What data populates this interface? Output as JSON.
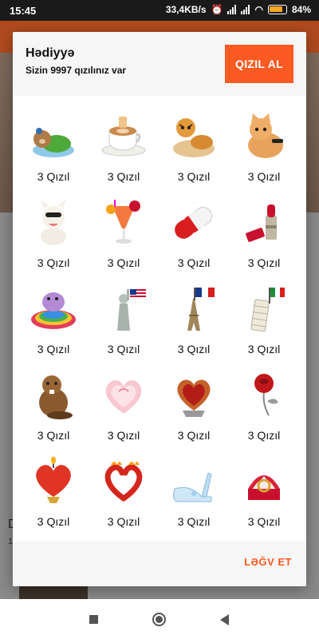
{
  "status_bar": {
    "time": "15:45",
    "net_speed": "33,4KB/s",
    "battery_text": "84%",
    "battery_level": 0.84
  },
  "background": {
    "text_line1": "D",
    "text_line2": "1"
  },
  "dialog": {
    "title": "Hədiyyə",
    "subtitle": "Sizin 9997 qızılınız var",
    "buy_button": "QIZIL AL",
    "cancel_button": "LƏĞV ET",
    "gifts": [
      {
        "icon": "sleeping-bear-icon",
        "price": "3 Qızıl"
      },
      {
        "icon": "coffee-cup-icon",
        "price": "3 Qızıl"
      },
      {
        "icon": "tiger-cub-icon",
        "price": "3 Qızıl"
      },
      {
        "icon": "cat-icon",
        "price": "3 Qızıl"
      },
      {
        "icon": "dog-icon",
        "price": "3 Qızıl"
      },
      {
        "icon": "cocktail-icon",
        "price": "3 Qızıl"
      },
      {
        "icon": "pill-icon",
        "price": "3 Qızıl"
      },
      {
        "icon": "lipstick-icon",
        "price": "3 Qızıl"
      },
      {
        "icon": "hippo-pool-icon",
        "price": "3 Qızıl"
      },
      {
        "icon": "statue-of-liberty-icon",
        "price": "3 Qızıl"
      },
      {
        "icon": "eiffel-tower-icon",
        "price": "3 Qızıl"
      },
      {
        "icon": "pisa-tower-icon",
        "price": "3 Qızıl"
      },
      {
        "icon": "beaver-icon",
        "price": "3 Qızıl"
      },
      {
        "icon": "heart-cake-icon",
        "price": "3 Qızıl"
      },
      {
        "icon": "heart-pie-icon",
        "price": "3 Qızıl"
      },
      {
        "icon": "rose-icon",
        "price": "3 Qızıl"
      },
      {
        "icon": "heart-candle-icon",
        "price": "3 Qızıl"
      },
      {
        "icon": "chili-heart-icon",
        "price": "3 Qızıl"
      },
      {
        "icon": "glass-slipper-icon",
        "price": "3 Qızıl"
      },
      {
        "icon": "ring-box-icon",
        "price": "3 Qızıl"
      }
    ]
  }
}
